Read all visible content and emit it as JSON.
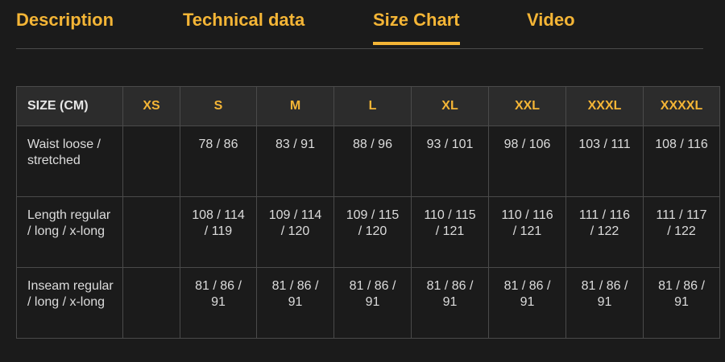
{
  "tabs": [
    {
      "label": "Description",
      "active": false
    },
    {
      "label": "Technical data",
      "active": false
    },
    {
      "label": "Size Chart",
      "active": true
    },
    {
      "label": "Video",
      "active": false
    }
  ],
  "accent_color": "#f4b536",
  "size_table": {
    "corner_label": "SIZE (CM)",
    "columns": [
      "XS",
      "S",
      "M",
      "L",
      "XL",
      "XXL",
      "XXXL",
      "XXXXL"
    ],
    "rows": [
      {
        "label": "Waist loose / stretched",
        "cells": [
          "",
          "78 / 86",
          "83 / 91",
          "88 / 96",
          "93 / 101",
          "98 / 106",
          "103 / 111",
          "108 / 116"
        ]
      },
      {
        "label": "Length regular / long / x-long",
        "cells": [
          "",
          "108 / 114 / 119",
          "109 / 114 / 120",
          "109 / 115 / 120",
          "110 / 115 / 121",
          "110 / 116 / 121",
          "111 / 116 / 122",
          "111 / 117 / 122"
        ]
      },
      {
        "label": "Inseam regular / long / x-long",
        "cells": [
          "",
          "81 / 86 / 91",
          "81 / 86 / 91",
          "81 / 86 / 91",
          "81 / 86 / 91",
          "81 / 86 / 91",
          "81 / 86 / 91",
          "81 / 86 / 91"
        ]
      }
    ]
  }
}
